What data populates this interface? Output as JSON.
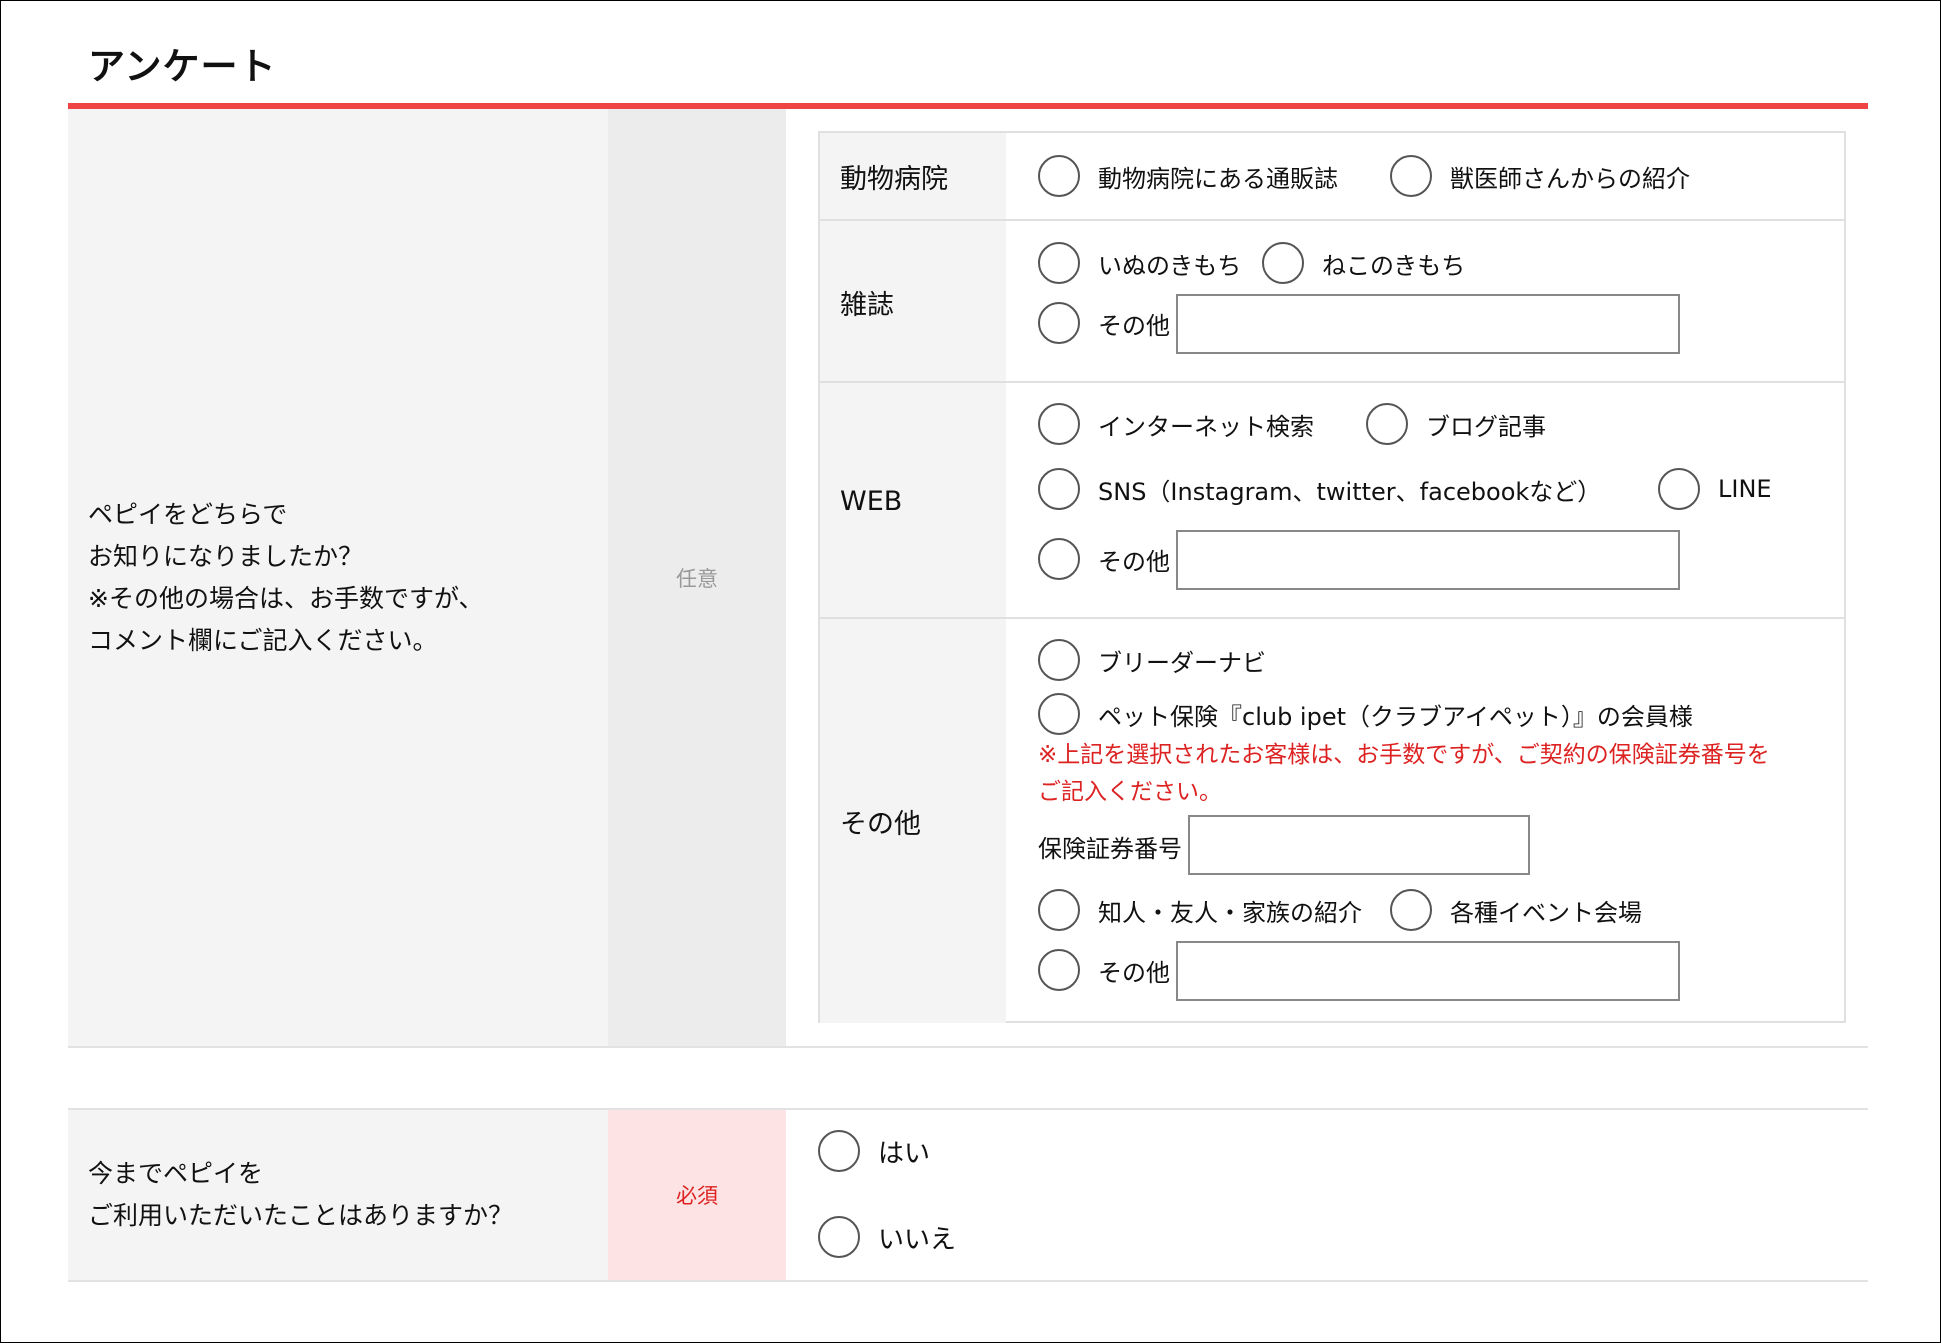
{
  "page": {
    "title": "アンケート",
    "accent_color": "#ee4444"
  },
  "q1": {
    "label_lines": [
      "ペピイをどちらで",
      "お知りになりましたか？",
      "※その他の場合は、お手数ですが、",
      "コメント欄にご記入ください。"
    ],
    "badge": "任意",
    "groups": {
      "vet": {
        "label": "動物病院",
        "options": [
          "動物病院にある通販誌",
          "獣医師さんからの紹介"
        ]
      },
      "magazine": {
        "label": "雑誌",
        "options": [
          "いぬのきもち",
          "ねこのきもち"
        ],
        "other_label": "その他",
        "other_value": ""
      },
      "web": {
        "label": "WEB",
        "options": [
          "インターネット検索",
          "ブログ記事",
          "SNS（Instagram、twitter、facebookなど）",
          "LINE"
        ],
        "other_label": "その他",
        "other_value": ""
      },
      "other": {
        "label": "その他",
        "options": [
          "ブリーダーナビ",
          "ペット保険『club ipet（クラブアイペット）』の会員様"
        ],
        "note": "※上記を選択されたお客様は、お手数ですが、ご契約の保険証券番号をご記入ください。",
        "policy_label": "保険証券番号",
        "policy_value": "",
        "options2": [
          "知人・友人・家族の紹介",
          "各種イベント会場"
        ],
        "other_label": "その他",
        "other_value": ""
      }
    }
  },
  "q2": {
    "label_lines": [
      "今までペピイを",
      "ご利用いただいたことはありますか？"
    ],
    "badge": "必須",
    "options": [
      "はい",
      "いいえ"
    ]
  }
}
